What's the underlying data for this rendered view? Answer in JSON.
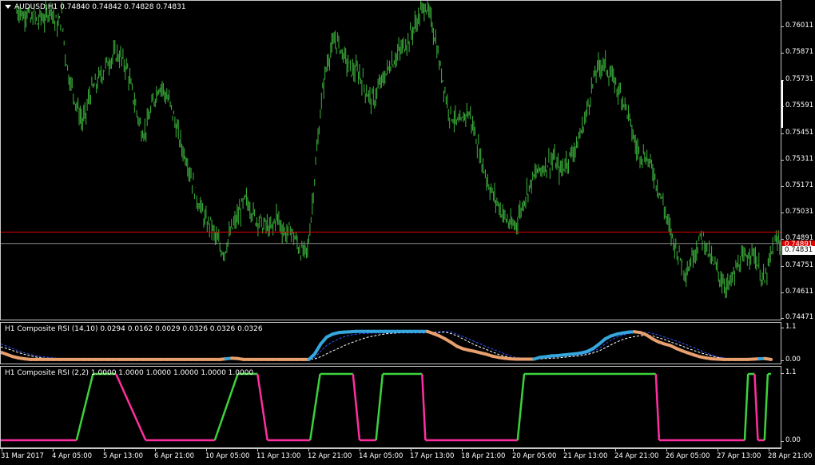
{
  "main": {
    "title": "AUDUSD,H1  0.74840 0.74842 0.74828 0.74831",
    "price_labels": [
      "0.76011",
      "0.75871",
      "0.75731",
      "0.75591",
      "0.75451",
      "0.75311",
      "0.75171",
      "0.75031",
      "0.74891",
      "0.74751",
      "0.74611",
      "0.74471"
    ],
    "bid_price": "0.74891",
    "last_price": "0.74831",
    "colors": {
      "bull": "#3cb43c",
      "bear": "#3cb43c",
      "bid_line": "#e00000",
      "last_line": "#8c8c8c"
    }
  },
  "indicator1": {
    "title": "H1 Composite RSI (14,10) 0.0294 0.0162 0.0029 0.0326 0.0326 0.0326",
    "scale_labels": [
      "1.1",
      "0.00"
    ],
    "colors": {
      "up": "#35a7dc",
      "down": "#e8a06e",
      "dash1": "#2d55ff",
      "dash2": "#ffffff"
    }
  },
  "indicator2": {
    "title": "H1 Composite RSI (2,2) 1.0000 1.0000 1.0000 1.0000 1.0000 1.0000",
    "scale_labels": [
      "1.1",
      "0.00"
    ],
    "colors": {
      "up": "#3cd23c",
      "down": "#ff2ea0"
    }
  },
  "time_labels": [
    "31 Mar 2017",
    "4 Apr 05:00",
    "5 Apr 13:00",
    "6 Apr 21:00",
    "10 Apr 05:00",
    "11 Apr 13:00",
    "12 Apr 21:00",
    "14 Apr 05:00",
    "17 Apr 13:00",
    "18 Apr 21:00",
    "20 Apr 05:00",
    "21 Apr 13:00",
    "24 Apr 21:00",
    "26 Apr 05:00",
    "27 Apr 13:00",
    "28 Apr 21:00"
  ],
  "chart_data": {
    "type": "line",
    "symbol": "AUDUSD",
    "timeframe": "H1",
    "ohlc_last": {
      "open": 0.7484,
      "high": 0.74842,
      "low": 0.74828,
      "close": 0.74831
    },
    "x": [
      "31 Mar 2017",
      "4 Apr 05:00",
      "5 Apr 13:00",
      "6 Apr 21:00",
      "10 Apr 05:00",
      "11 Apr 13:00",
      "12 Apr 21:00",
      "14 Apr 05:00",
      "17 Apr 13:00",
      "18 Apr 21:00",
      "20 Apr 05:00",
      "21 Apr 13:00",
      "24 Apr 21:00",
      "26 Apr 05:00",
      "27 Apr 13:00",
      "28 Apr 21:00"
    ],
    "price_ylim": [
      0.7443,
      0.7611
    ],
    "close_path": [
      [
        0.7605,
        0.7606,
        0.7602,
        0.7607,
        0.76,
        0.7604,
        0.7599,
        0.7603,
        0.7601,
        0.7605,
        0.7608,
        0.76,
        0.7598,
        0.7603
      ],
      [
        0.7583,
        0.7572,
        0.7565,
        0.7558,
        0.7552,
        0.7547,
        0.7552,
        0.7561,
        0.7565,
        0.7567,
        0.7571,
        0.7574,
        0.7578,
        0.758
      ],
      [
        0.7582,
        0.7583,
        0.7581,
        0.7578,
        0.7575,
        0.7565,
        0.7558,
        0.755,
        0.7543,
        0.7542,
        0.7548,
        0.7555,
        0.7561,
        0.7566
      ],
      [
        0.7566,
        0.7561,
        0.7558,
        0.7552,
        0.7545,
        0.7538,
        0.7532,
        0.7528,
        0.7521,
        0.7514,
        0.7507,
        0.7503,
        0.7497,
        0.7493
      ],
      [
        0.7494,
        0.7488,
        0.7484,
        0.748,
        0.7479,
        0.7485,
        0.749,
        0.7494,
        0.7498,
        0.7502,
        0.7506,
        0.7504,
        0.75,
        0.7496
      ],
      [
        0.7496,
        0.7492,
        0.7493,
        0.749,
        0.7492,
        0.7498,
        0.7494,
        0.749,
        0.7488,
        0.7491,
        0.7487,
        0.7483,
        0.7479,
        0.7478
      ],
      [
        0.748,
        0.7497,
        0.7518,
        0.7538,
        0.7558,
        0.7572,
        0.7581,
        0.7586,
        0.759,
        0.7588,
        0.7584,
        0.758,
        0.7576,
        0.7574
      ],
      [
        0.7574,
        0.7572,
        0.7568,
        0.7563,
        0.756,
        0.7558,
        0.7563,
        0.7567,
        0.757,
        0.7574,
        0.7578,
        0.758,
        0.7583,
        0.7585
      ],
      [
        0.7588,
        0.759,
        0.7594,
        0.7598,
        0.7602,
        0.7606,
        0.7609,
        0.7604,
        0.7598,
        0.759,
        0.7578,
        0.757,
        0.756,
        0.7552
      ],
      [
        0.755,
        0.7547,
        0.7545,
        0.7549,
        0.7553,
        0.755,
        0.7543,
        0.7536,
        0.7528,
        0.7522,
        0.7516,
        0.7511,
        0.7507,
        0.7504
      ],
      [
        0.75,
        0.7497,
        0.7494,
        0.7492,
        0.7493,
        0.7498,
        0.7503,
        0.7509,
        0.7513,
        0.7517,
        0.752,
        0.7522,
        0.7523,
        0.7525
      ],
      [
        0.7526,
        0.7528,
        0.7524,
        0.7521,
        0.7524,
        0.7527,
        0.753,
        0.7533,
        0.7536,
        0.7542,
        0.7548,
        0.7556,
        0.7564,
        0.7572
      ],
      [
        0.7576,
        0.7578,
        0.7577,
        0.7573,
        0.757,
        0.7567,
        0.7563,
        0.756,
        0.7555,
        0.7548,
        0.754,
        0.7533,
        0.7531,
        0.753
      ],
      [
        0.7528,
        0.7525,
        0.752,
        0.7514,
        0.7508,
        0.7502,
        0.7494,
        0.7488,
        0.7483,
        0.7478,
        0.7474,
        0.7469,
        0.747,
        0.7476
      ],
      [
        0.748,
        0.7484,
        0.7487,
        0.7483,
        0.7477,
        0.7473,
        0.747,
        0.7466,
        0.7463,
        0.746,
        0.7462,
        0.7466,
        0.747,
        0.7474
      ],
      [
        0.7474,
        0.7477,
        0.7479,
        0.7478,
        0.7472,
        0.7466,
        0.7463,
        0.747,
        0.7478,
        0.7483,
        0.7484,
        0.7483
      ]
    ],
    "indicator1_ylim": [
      0.0,
      1.1
    ],
    "indicator1_main": [
      0.27,
      0.2,
      0.13,
      0.08,
      0.05,
      0.03,
      0.03,
      0.03,
      0.03,
      0.03,
      0.03,
      0.03,
      0.03,
      0.03,
      0.03,
      0.03,
      0.03,
      0.03,
      0.03,
      0.03,
      0.03,
      0.03,
      0.03,
      0.03,
      0.03,
      0.03,
      0.03,
      0.03,
      0.03,
      0.03,
      0.03,
      0.03,
      0.03,
      0.03,
      0.03,
      0.03,
      0.03,
      0.03,
      0.05,
      0.07,
      0.06,
      0.03,
      0.03,
      0.03,
      0.03,
      0.03,
      0.03,
      0.03,
      0.03,
      0.03,
      0.03,
      0.03,
      0.03,
      0.22,
      0.55,
      0.78,
      0.88,
      0.93,
      0.95,
      0.96,
      0.97,
      0.97,
      0.97,
      0.97,
      0.97,
      0.97,
      0.97,
      0.97,
      0.97,
      0.97,
      0.97,
      0.97,
      0.97,
      0.9,
      0.82,
      0.72,
      0.6,
      0.47,
      0.39,
      0.34,
      0.3,
      0.25,
      0.2,
      0.14,
      0.1,
      0.07,
      0.05,
      0.04,
      0.04,
      0.04,
      0.04,
      0.1,
      0.12,
      0.15,
      0.16,
      0.18,
      0.2,
      0.22,
      0.25,
      0.3,
      0.4,
      0.55,
      0.72,
      0.82,
      0.88,
      0.92,
      0.95,
      0.96,
      0.93,
      0.85,
      0.72,
      0.62,
      0.55,
      0.5,
      0.4,
      0.32,
      0.25,
      0.18,
      0.12,
      0.08,
      0.05,
      0.04,
      0.03,
      0.03,
      0.03,
      0.03,
      0.03,
      0.04,
      0.05,
      0.06,
      0.03
    ],
    "indicator1_dash_blue": [
      0.55,
      0.48,
      0.4,
      0.32,
      0.25,
      0.2,
      0.15,
      0.12,
      0.1,
      0.08,
      0.06,
      0.05,
      0.04,
      0.04,
      0.04,
      0.04,
      0.04,
      0.04,
      0.04,
      0.04,
      0.04,
      0.04,
      0.04,
      0.04,
      0.04,
      0.04,
      0.04,
      0.04,
      0.04,
      0.04,
      0.04,
      0.04,
      0.04,
      0.04,
      0.04,
      0.04,
      0.04,
      0.04,
      0.05,
      0.06,
      0.06,
      0.05,
      0.04,
      0.04,
      0.04,
      0.04,
      0.04,
      0.04,
      0.04,
      0.04,
      0.04,
      0.04,
      0.04,
      0.1,
      0.3,
      0.5,
      0.62,
      0.72,
      0.8,
      0.85,
      0.88,
      0.9,
      0.91,
      0.92,
      0.92,
      0.92,
      0.92,
      0.92,
      0.92,
      0.92,
      0.92,
      0.92,
      0.92,
      0.94,
      0.96,
      0.97,
      0.95,
      0.88,
      0.8,
      0.72,
      0.62,
      0.55,
      0.45,
      0.38,
      0.3,
      0.22,
      0.15,
      0.1,
      0.07,
      0.05,
      0.05,
      0.06,
      0.08,
      0.1,
      0.12,
      0.14,
      0.16,
      0.18,
      0.2,
      0.24,
      0.3,
      0.4,
      0.55,
      0.68,
      0.78,
      0.85,
      0.9,
      0.93,
      0.94,
      0.94,
      0.9,
      0.85,
      0.78,
      0.72,
      0.65,
      0.58,
      0.5,
      0.42,
      0.34,
      0.25,
      0.18,
      0.12,
      0.08,
      0.05,
      0.04,
      0.04,
      0.04,
      0.04,
      0.05,
      0.06,
      0.05
    ],
    "indicator1_dash_white": [
      0.45,
      0.4,
      0.33,
      0.26,
      0.2,
      0.15,
      0.11,
      0.08,
      0.06,
      0.05,
      0.04,
      0.04,
      0.04,
      0.04,
      0.04,
      0.04,
      0.04,
      0.04,
      0.04,
      0.04,
      0.04,
      0.04,
      0.04,
      0.04,
      0.04,
      0.04,
      0.04,
      0.04,
      0.04,
      0.04,
      0.04,
      0.04,
      0.04,
      0.04,
      0.04,
      0.04,
      0.04,
      0.04,
      0.04,
      0.05,
      0.05,
      0.04,
      0.04,
      0.04,
      0.04,
      0.04,
      0.04,
      0.04,
      0.04,
      0.04,
      0.04,
      0.04,
      0.04,
      0.05,
      0.12,
      0.22,
      0.32,
      0.4,
      0.5,
      0.58,
      0.65,
      0.72,
      0.78,
      0.82,
      0.86,
      0.89,
      0.91,
      0.92,
      0.93,
      0.93,
      0.93,
      0.93,
      0.93,
      0.93,
      0.94,
      0.95,
      0.9,
      0.82,
      0.72,
      0.62,
      0.52,
      0.44,
      0.36,
      0.28,
      0.2,
      0.14,
      0.09,
      0.06,
      0.05,
      0.04,
      0.04,
      0.05,
      0.06,
      0.07,
      0.08,
      0.1,
      0.12,
      0.14,
      0.16,
      0.2,
      0.25,
      0.32,
      0.42,
      0.52,
      0.62,
      0.7,
      0.76,
      0.8,
      0.83,
      0.84,
      0.82,
      0.76,
      0.7,
      0.62,
      0.55,
      0.48,
      0.4,
      0.33,
      0.26,
      0.2,
      0.15,
      0.1,
      0.07,
      0.05,
      0.04,
      0.04,
      0.04,
      0.04,
      0.04,
      0.05,
      0.04
    ],
    "indicator2_ylim": [
      0.0,
      1.1
    ],
    "indicator2_states": [
      [
        0,
        0
      ],
      [
        23,
        0
      ],
      [
        28,
        1
      ],
      [
        35,
        1
      ],
      [
        44,
        0
      ],
      [
        65,
        0
      ],
      [
        72,
        1
      ],
      [
        78,
        1
      ],
      [
        81,
        0
      ],
      [
        94,
        0
      ],
      [
        97,
        1
      ],
      [
        107,
        1
      ],
      [
        109,
        0
      ],
      [
        114,
        0
      ],
      [
        116,
        1
      ],
      [
        128,
        1
      ],
      [
        129,
        0
      ],
      [
        157,
        0
      ],
      [
        159,
        1
      ],
      [
        199,
        1
      ],
      [
        200,
        0
      ],
      [
        226,
        0
      ],
      [
        227,
        1
      ],
      [
        229,
        1
      ],
      [
        230,
        0
      ],
      [
        232,
        0
      ],
      [
        233,
        1
      ],
      [
        234,
        1
      ]
    ],
    "indicator2_bars": 234
  }
}
